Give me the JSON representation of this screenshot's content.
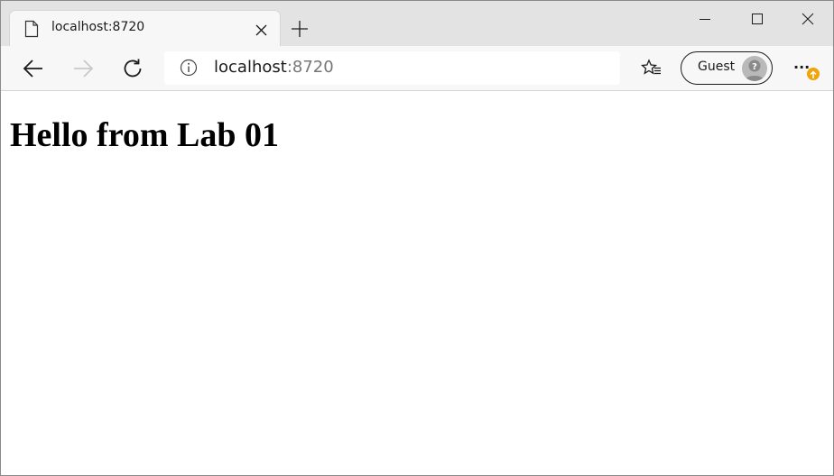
{
  "tab": {
    "title": "localhost:8720",
    "favicon_icon": "page-icon",
    "close_icon": "close-icon"
  },
  "window_controls": {
    "minimize_icon": "minimize-icon",
    "maximize_icon": "maximize-icon",
    "close_icon": "close-icon"
  },
  "toolbar": {
    "back_icon": "arrow-left-icon",
    "forward_icon": "arrow-right-icon",
    "forward_enabled": false,
    "refresh_icon": "refresh-icon",
    "favorites_icon": "star-list-icon",
    "menu_icon": "ellipsis-icon",
    "update_badge_icon": "arrow-up-icon",
    "update_badge_color": "#f0a30a"
  },
  "address": {
    "info_icon": "info-icon",
    "host": "localhost",
    "port": ":8720"
  },
  "profile": {
    "label": "Guest",
    "avatar_icon": "avatar-question-icon"
  },
  "page": {
    "heading": "Hello from Lab 01"
  }
}
